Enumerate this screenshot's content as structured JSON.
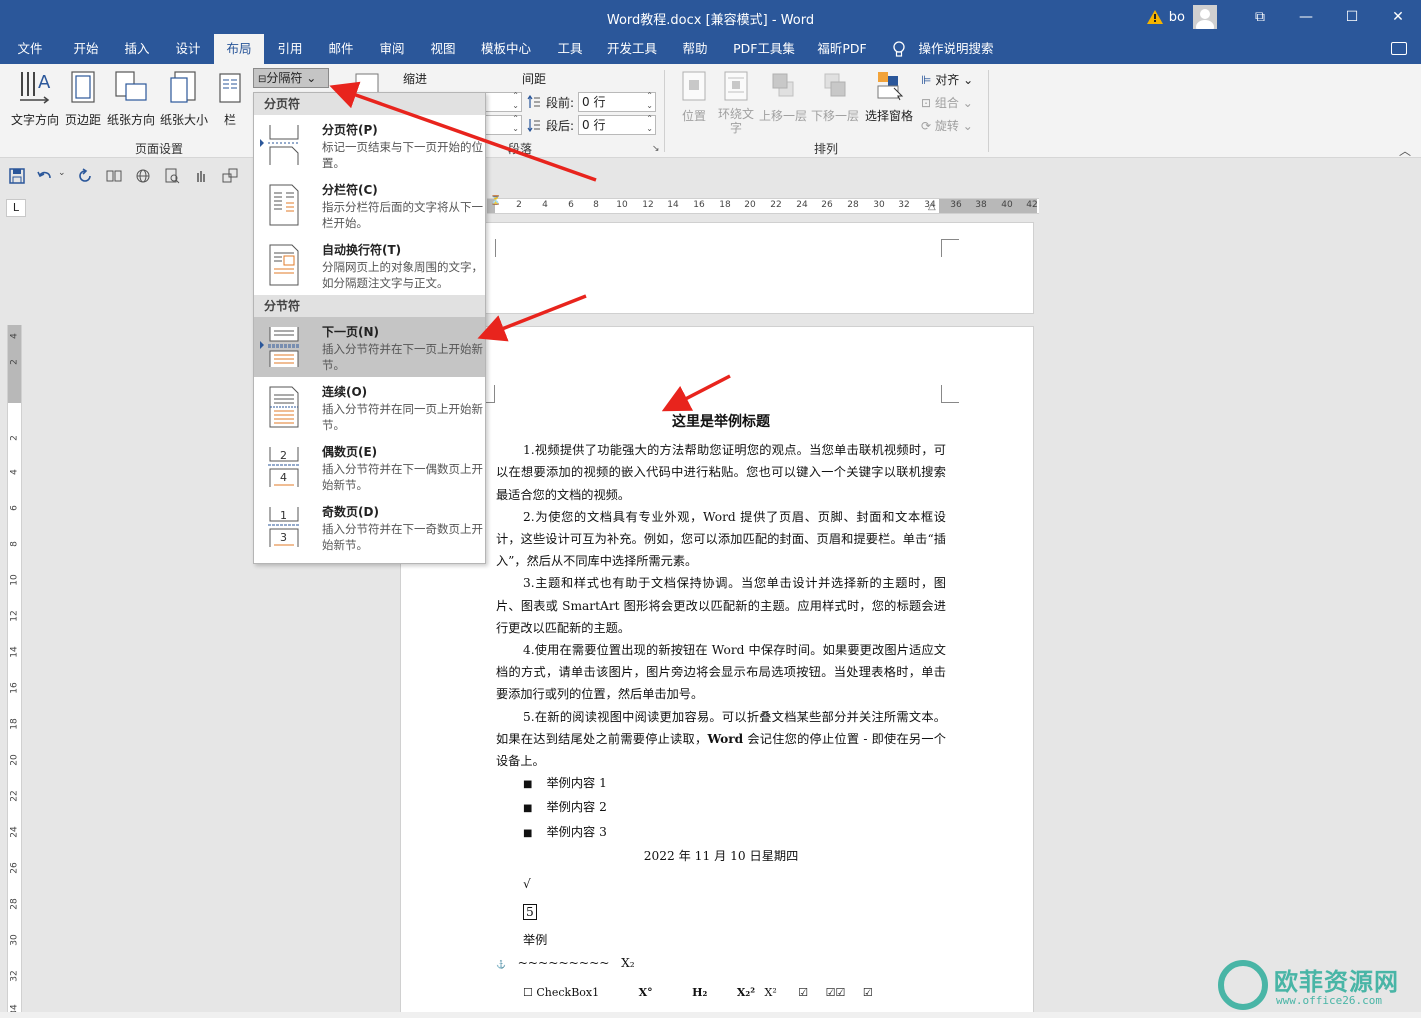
{
  "titlebar": {
    "title": "Word教程.docx [兼容模式]  -  Word",
    "user": "bo",
    "minimize": "—",
    "maximize": "☐",
    "close": "✕",
    "ribbon_display": "⧉"
  },
  "tabs": [
    "文件",
    "开始",
    "插入",
    "设计",
    "布局",
    "引用",
    "邮件",
    "审阅",
    "视图",
    "模板中心",
    "工具",
    "开发工具",
    "帮助",
    "PDF工具集",
    "福昕PDF"
  ],
  "tell_me": "操作说明搜索",
  "ribbon": {
    "page_setup": {
      "text_direction": "文字方向",
      "margins": "页边距",
      "orientation": "纸张方向",
      "size": "纸张大小",
      "columns": "栏",
      "label": "页面设置"
    },
    "breaks_button": "分隔符",
    "indent_label": "缩进",
    "spacing_label": "间距",
    "before_label": "段前:",
    "after_label": "段后:",
    "before_value": "0 行",
    "after_value": "0 行",
    "paragraph_label": "段落",
    "arrange": {
      "position": "位置",
      "wrap_l1": "环绕文",
      "wrap_l2": "字",
      "forward": "上移一层",
      "backward": "下移一层",
      "selection_pane": "选择窗格",
      "align": "对齐",
      "group": "组合",
      "rotate": "旋转",
      "label": "排列"
    }
  },
  "breaks_menu": {
    "page_breaks_header": "分页符",
    "section_breaks_header": "分节符",
    "items": [
      {
        "title": "分页符(P)",
        "desc": "标记一页结束与下一页开始的位置。"
      },
      {
        "title": "分栏符(C)",
        "desc": "指示分栏符后面的文字将从下一栏开始。"
      },
      {
        "title": "自动换行符(T)",
        "desc": "分隔网页上的对象周围的文字，如分隔题注文字与正文。"
      },
      {
        "title": "下一页(N)",
        "desc": "插入分节符并在下一页上开始新节。"
      },
      {
        "title": "连续(O)",
        "desc": "插入分节符并在同一页上开始新节。"
      },
      {
        "title": "偶数页(E)",
        "desc": "插入分节符并在下一偶数页上开始新节。"
      },
      {
        "title": "奇数页(D)",
        "desc": "插入分节符并在下一奇数页上开始新节。"
      }
    ],
    "even_icon_nums": [
      "2",
      "4"
    ],
    "odd_icon_nums": [
      "1",
      "3"
    ]
  },
  "ruler": {
    "h_numbers": [
      "2",
      "4",
      "6",
      "8",
      "10",
      "12",
      "14",
      "16",
      "18",
      "20",
      "22",
      "24",
      "26",
      "28",
      "30",
      "32",
      "34",
      "36",
      "38",
      "40",
      "42"
    ],
    "v_numbers": [
      "4",
      "2",
      "2",
      "4",
      "6",
      "8",
      "10",
      "12",
      "14",
      "16",
      "18",
      "20",
      "22",
      "24",
      "26",
      "28",
      "30",
      "32",
      "34"
    ],
    "corner": "L"
  },
  "document": {
    "heading": "这里是举例标题",
    "paragraphs": [
      "1.视频提供了功能强大的方法帮助您证明您的观点。当您单击联机视频时，可以在想要添加的视频的嵌入代码中进行粘贴。您也可以键入一个关键字以联机搜索最适合您的文档的视频。",
      "2.为使您的文档具有专业外观，Word 提供了页眉、页脚、封面和文本框设计，这些设计可互为补充。例如，您可以添加匹配的封面、页眉和提要栏。单击“插入”，然后从不同库中选择所需元素。",
      "3.主题和样式也有助于文档保持协调。当您单击设计并选择新的主题时，图片、图表或 SmartArt 图形将会更改以匹配新的主题。应用样式时，您的标题会进行更改以匹配新的主题。",
      "4.使用在需要位置出现的新按钮在 Word 中保存时间。如果要更改图片适应文档的方式，请单击该图片，图片旁边将会显示布局选项按钮。当处理表格时，单击要添加行或列的位置，然后单击加号。"
    ],
    "para5_a": "5.在新的阅读视图中阅读更加容易。可以折叠文档某些部分并关注所需文本。如果在达到结尾处之前需要停止读取，",
    "para5_bold": "Word",
    "para5_b": " 会记住您的停止位置 - 即使在另一个设备上。",
    "bullets": [
      "举例内容 1",
      "举例内容 2",
      "举例内容 3"
    ],
    "date": "2022 年 11 月 10 日星期四",
    "check_glyph": "√",
    "boxed_number": "5",
    "example": "举例",
    "tilde_line": "~~~~~~~~~",
    "x_sub": "X₂",
    "checkbox_label": "☐ CheckBox1",
    "symbols": [
      "X°",
      "H₂",
      "X₂²",
      "X²",
      "☑",
      "☑☑",
      "☑"
    ],
    "last_check": "☑"
  },
  "watermark": {
    "text": "欧菲资源网",
    "url": "www.office26.com"
  },
  "colors": {
    "word_blue": "#2b579a",
    "arrow_red": "#e8241d",
    "watermark_teal": "#49b5a6"
  }
}
